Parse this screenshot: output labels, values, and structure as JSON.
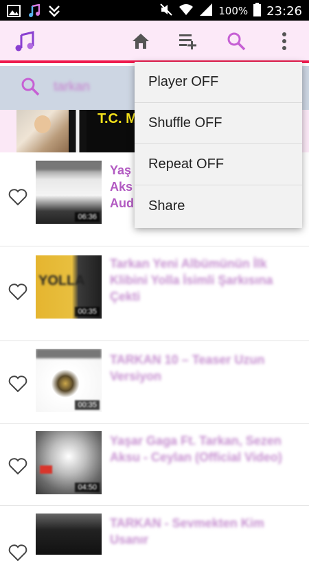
{
  "status_bar": {
    "battery": "100%",
    "time": "23:26"
  },
  "search": {
    "query": "tarkan"
  },
  "banner": {
    "text": "T.C. M"
  },
  "videos": [
    {
      "title": "Yaş Aks Aud",
      "duration": "06:36"
    },
    {
      "title": "Tarkan Yeni Albümünün İlk Klibini Yolla İsimli Şarkısına Çekti",
      "duration": "00:35",
      "thumb_text": "YOLLA"
    },
    {
      "title": "TARKAN 10 – Teaser Uzun Versiyon",
      "duration": "00:35"
    },
    {
      "title": "Yaşar Gaga Ft. Tarkan, Sezen Aksu - Ceylan (Official Video)",
      "duration": "04:50"
    },
    {
      "title": "TARKAN - Sevmekten Kim Usanır",
      "duration": ""
    }
  ],
  "menu": {
    "items": [
      "Player OFF",
      "Shuffle OFF",
      "Repeat OFF",
      "Share"
    ]
  },
  "colors": {
    "accent": "#ee1c4e",
    "toolbar_bg": "#fce9f8",
    "title_purple": "#b25ac2",
    "search_bg": "#cdd6e3"
  }
}
